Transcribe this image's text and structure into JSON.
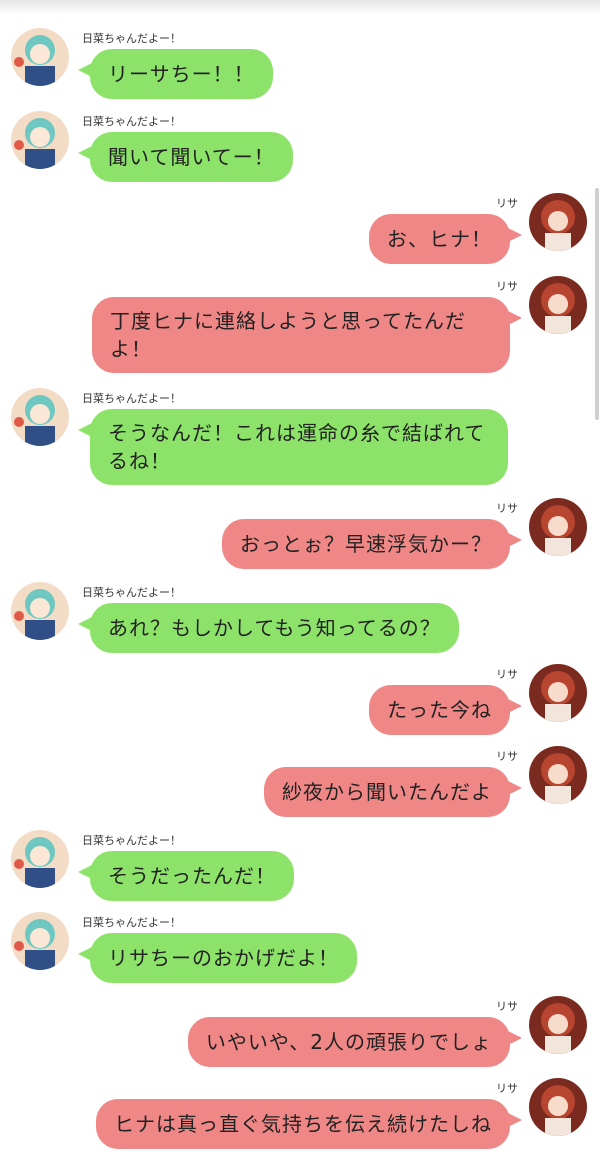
{
  "chat": {
    "participants": {
      "hina": {
        "name": "日菜ちゃんだよー！",
        "bubble_color": "#8de36a"
      },
      "lisa": {
        "name": "リサ",
        "bubble_color": "#ef8786"
      }
    },
    "messages": [
      {
        "sender": "日菜ちゃんだよー！",
        "text": "リーサちー！！"
      },
      {
        "sender": "日菜ちゃんだよー！",
        "text": "聞いて聞いてー！"
      },
      {
        "sender": "リサ",
        "text": "お、ヒナ！"
      },
      {
        "sender": "リサ",
        "text": "丁度ヒナに連絡しようと思ってたんだよ！"
      },
      {
        "sender": "日菜ちゃんだよー！",
        "text": "そうなんだ！これは運命の糸で結ばれてるね！"
      },
      {
        "sender": "リサ",
        "text": "おっとぉ？早速浮気かー？"
      },
      {
        "sender": "日菜ちゃんだよー！",
        "text": "あれ？もしかしてもう知ってるの？"
      },
      {
        "sender": "リサ",
        "text": "たった今ね"
      },
      {
        "sender": "リサ",
        "text": "紗夜から聞いたんだよ"
      },
      {
        "sender": "日菜ちゃんだよー！",
        "text": "そうだったんだ！"
      },
      {
        "sender": "日菜ちゃんだよー！",
        "text": "リサちーのおかげだよ！"
      },
      {
        "sender": "リサ",
        "text": "いやいや、2人の頑張りでしょ"
      },
      {
        "sender": "リサ",
        "text": "ヒナは真っ直ぐ気持ちを伝え続けたしね"
      }
    ]
  }
}
